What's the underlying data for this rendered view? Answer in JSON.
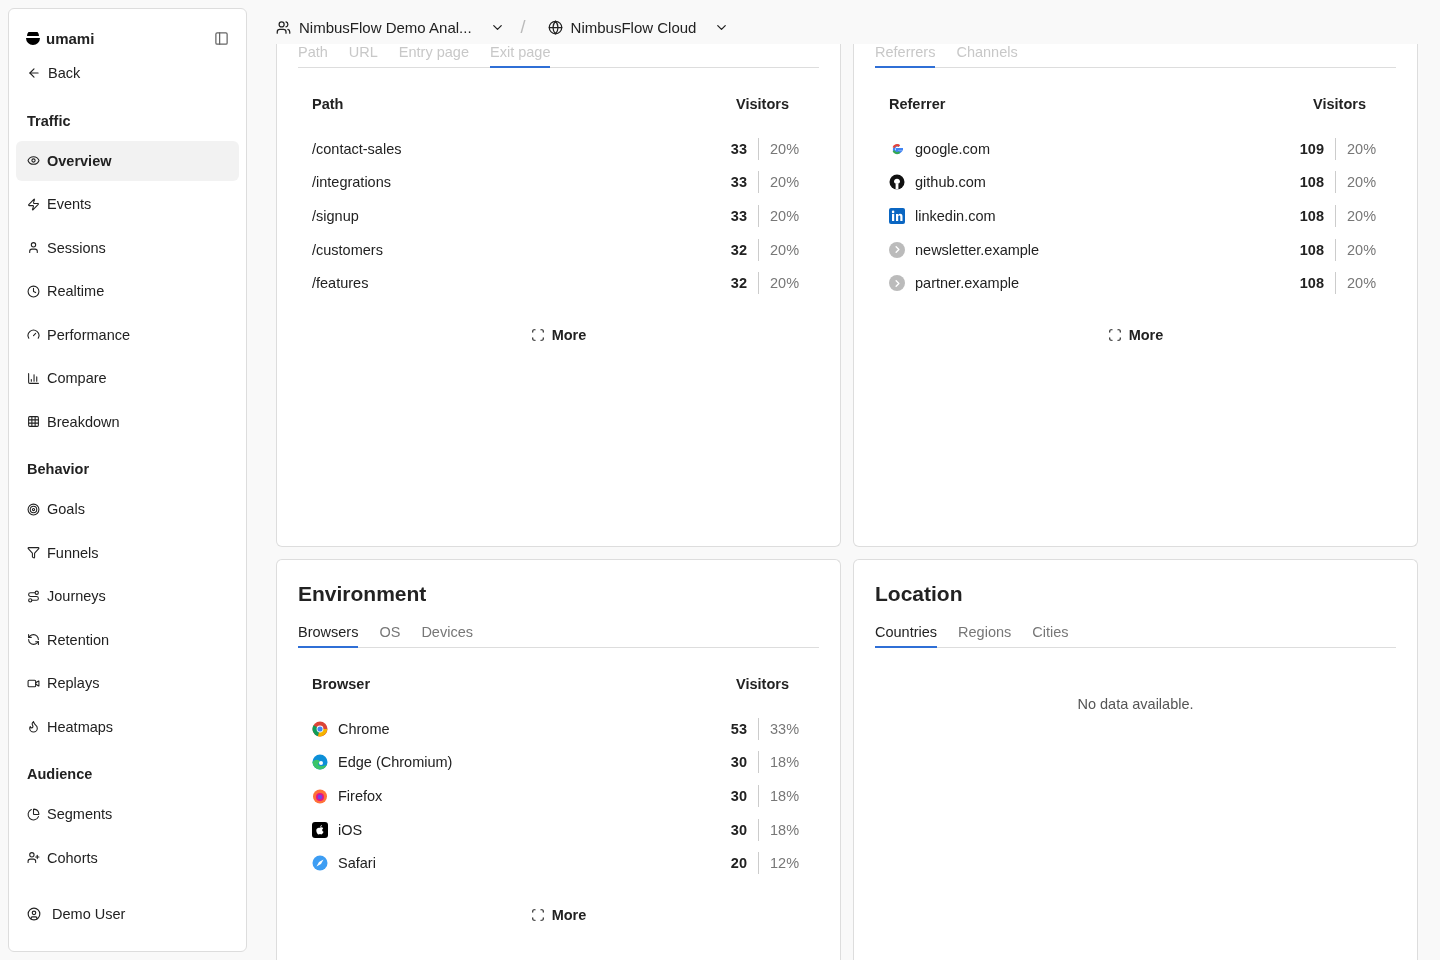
{
  "sidebar": {
    "logo": "umami",
    "back": "Back",
    "sections": [
      {
        "title": "Traffic",
        "items": [
          {
            "label": "Overview",
            "selected": true
          },
          {
            "label": "Events",
            "selected": false
          },
          {
            "label": "Sessions",
            "selected": false
          },
          {
            "label": "Realtime",
            "selected": false
          },
          {
            "label": "Performance",
            "selected": false
          },
          {
            "label": "Compare",
            "selected": false
          },
          {
            "label": "Breakdown",
            "selected": false
          }
        ]
      },
      {
        "title": "Behavior",
        "items": [
          {
            "label": "Goals",
            "selected": false
          },
          {
            "label": "Funnels",
            "selected": false
          },
          {
            "label": "Journeys",
            "selected": false
          },
          {
            "label": "Retention",
            "selected": false
          },
          {
            "label": "Replays",
            "selected": false
          },
          {
            "label": "Heatmaps",
            "selected": false
          }
        ]
      },
      {
        "title": "Audience",
        "items": [
          {
            "label": "Segments",
            "selected": false
          },
          {
            "label": "Cohorts",
            "selected": false
          }
        ]
      }
    ],
    "user": "Demo User"
  },
  "header": {
    "team": "NimbusFlow Demo Anal...",
    "separator": "/",
    "website": "NimbusFlow Cloud"
  },
  "cards": [
    {
      "tabs": [
        {
          "label": "Path",
          "selected": false
        },
        {
          "label": "URL",
          "selected": false
        },
        {
          "label": "Entry page",
          "selected": false
        },
        {
          "label": "Exit page",
          "selected": true
        }
      ],
      "columns": [
        "Path",
        "Visitors"
      ],
      "rows": [
        {
          "kind": "plain",
          "label": "/contact-sales",
          "value": "33",
          "percent": "20%"
        },
        {
          "kind": "plain",
          "label": "/integrations",
          "value": "33",
          "percent": "20%"
        },
        {
          "kind": "plain",
          "label": "/signup",
          "value": "33",
          "percent": "20%"
        },
        {
          "kind": "plain",
          "label": "/customers",
          "value": "32",
          "percent": "20%"
        },
        {
          "kind": "plain",
          "label": "/features",
          "value": "32",
          "percent": "20%"
        }
      ],
      "more": "More"
    },
    {
      "tabs": [
        {
          "label": "Referrers",
          "selected": true
        },
        {
          "label": "Channels",
          "selected": false
        }
      ],
      "columns": [
        "Referrer",
        "Visitors"
      ],
      "rows": [
        {
          "kind": "google",
          "label": "google.com",
          "value": "109",
          "percent": "20%"
        },
        {
          "kind": "github",
          "label": "github.com",
          "value": "108",
          "percent": "20%"
        },
        {
          "kind": "linkedin",
          "label": "linkedin.com",
          "value": "108",
          "percent": "20%"
        },
        {
          "kind": "generic",
          "label": "newsletter.example",
          "value": "108",
          "percent": "20%"
        },
        {
          "kind": "generic",
          "label": "partner.example",
          "value": "108",
          "percent": "20%"
        }
      ],
      "more": "More"
    },
    {
      "title": "Environment",
      "tabs": [
        {
          "label": "Browsers",
          "selected": true
        },
        {
          "label": "OS",
          "selected": false
        },
        {
          "label": "Devices",
          "selected": false
        }
      ],
      "columns": [
        "Browser",
        "Visitors"
      ],
      "rows": [
        {
          "kind": "chrome",
          "label": "Chrome",
          "value": "53",
          "percent": "33%"
        },
        {
          "kind": "edge",
          "label": "Edge (Chromium)",
          "value": "30",
          "percent": "18%"
        },
        {
          "kind": "firefox",
          "label": "Firefox",
          "value": "30",
          "percent": "18%"
        },
        {
          "kind": "ios",
          "label": "iOS",
          "value": "30",
          "percent": "18%"
        },
        {
          "kind": "safari",
          "label": "Safari",
          "value": "20",
          "percent": "12%"
        }
      ],
      "more": "More"
    },
    {
      "title": "Location",
      "tabs": [
        {
          "label": "Countries",
          "selected": true
        },
        {
          "label": "Regions",
          "selected": false
        },
        {
          "label": "Cities",
          "selected": false
        }
      ],
      "empty": "No data available."
    }
  ]
}
